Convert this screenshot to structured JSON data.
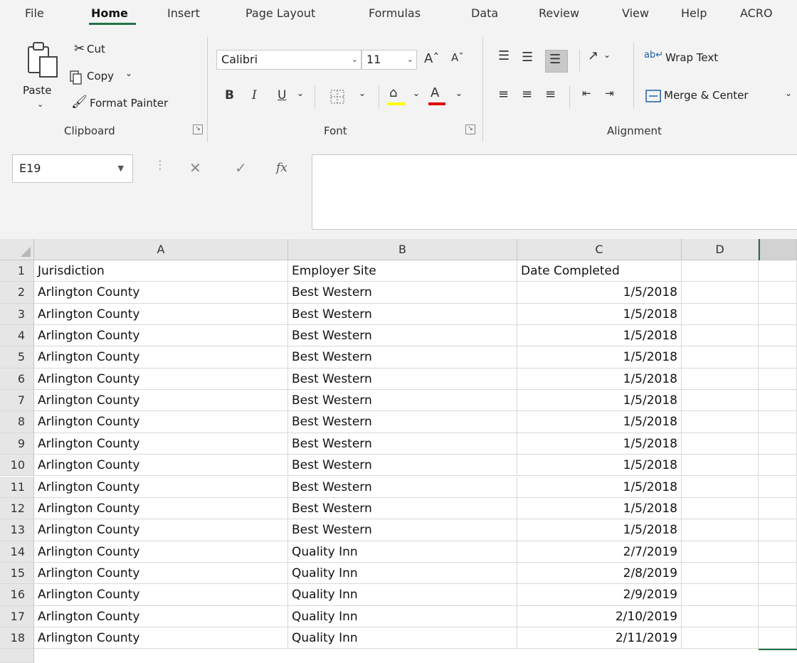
{
  "tabs": [
    "File",
    "Home",
    "Insert",
    "Page Layout",
    "Formulas",
    "Data",
    "Review",
    "View",
    "Help",
    "ACRO"
  ],
  "active_tab": "Home",
  "clipboard": {
    "paste": "Paste",
    "cut": "Cut",
    "copy": "Copy",
    "format_painter": "Format Painter",
    "group_label": "Clipboard"
  },
  "font": {
    "family": "Calibri",
    "size": "11",
    "bold": "B",
    "italic": "I",
    "underline": "U",
    "font_color_glyph": "A",
    "group_label": "Font",
    "highlight_color": "#ffff00",
    "font_color": "#e00000"
  },
  "alignment": {
    "wrap_text": "Wrap Text",
    "merge_center": "Merge & Center",
    "group_label": "Alignment"
  },
  "formula_bar": {
    "name_box": "E19",
    "fx": "fx",
    "value": ""
  },
  "columns": [
    "A",
    "B",
    "C",
    "D"
  ],
  "rows": [
    {
      "n": "1",
      "a": "Jurisdiction",
      "b": "Employer Site",
      "c": "Date Completed"
    },
    {
      "n": "2",
      "a": "Arlington County",
      "b": "Best Western",
      "c": "1/5/2018"
    },
    {
      "n": "3",
      "a": "Arlington County",
      "b": "Best Western",
      "c": "1/5/2018"
    },
    {
      "n": "4",
      "a": "Arlington County",
      "b": "Best Western",
      "c": "1/5/2018"
    },
    {
      "n": "5",
      "a": "Arlington County",
      "b": "Best Western",
      "c": "1/5/2018"
    },
    {
      "n": "6",
      "a": "Arlington County",
      "b": "Best Western",
      "c": "1/5/2018"
    },
    {
      "n": "7",
      "a": "Arlington County",
      "b": "Best Western",
      "c": "1/5/2018"
    },
    {
      "n": "8",
      "a": "Arlington County",
      "b": "Best Western",
      "c": "1/5/2018"
    },
    {
      "n": "9",
      "a": "Arlington County",
      "b": "Best Western",
      "c": "1/5/2018"
    },
    {
      "n": "10",
      "a": "Arlington County",
      "b": "Best Western",
      "c": "1/5/2018"
    },
    {
      "n": "11",
      "a": "Arlington County",
      "b": "Best Western",
      "c": "1/5/2018"
    },
    {
      "n": "12",
      "a": "Arlington County",
      "b": "Best Western",
      "c": "1/5/2018"
    },
    {
      "n": "13",
      "a": "Arlington County",
      "b": "Best Western",
      "c": "1/5/2018"
    },
    {
      "n": "14",
      "a": "Arlington County",
      "b": "Quality Inn",
      "c": "2/7/2019"
    },
    {
      "n": "15",
      "a": "Arlington County",
      "b": "Quality Inn",
      "c": "2/8/2019"
    },
    {
      "n": "16",
      "a": "Arlington County",
      "b": "Quality Inn",
      "c": "2/9/2019"
    },
    {
      "n": "17",
      "a": "Arlington County",
      "b": "Quality Inn",
      "c": "2/10/2019"
    },
    {
      "n": "18",
      "a": "Arlington County",
      "b": "Quality Inn",
      "c": "2/11/2019"
    }
  ],
  "accent_color": "#217346"
}
